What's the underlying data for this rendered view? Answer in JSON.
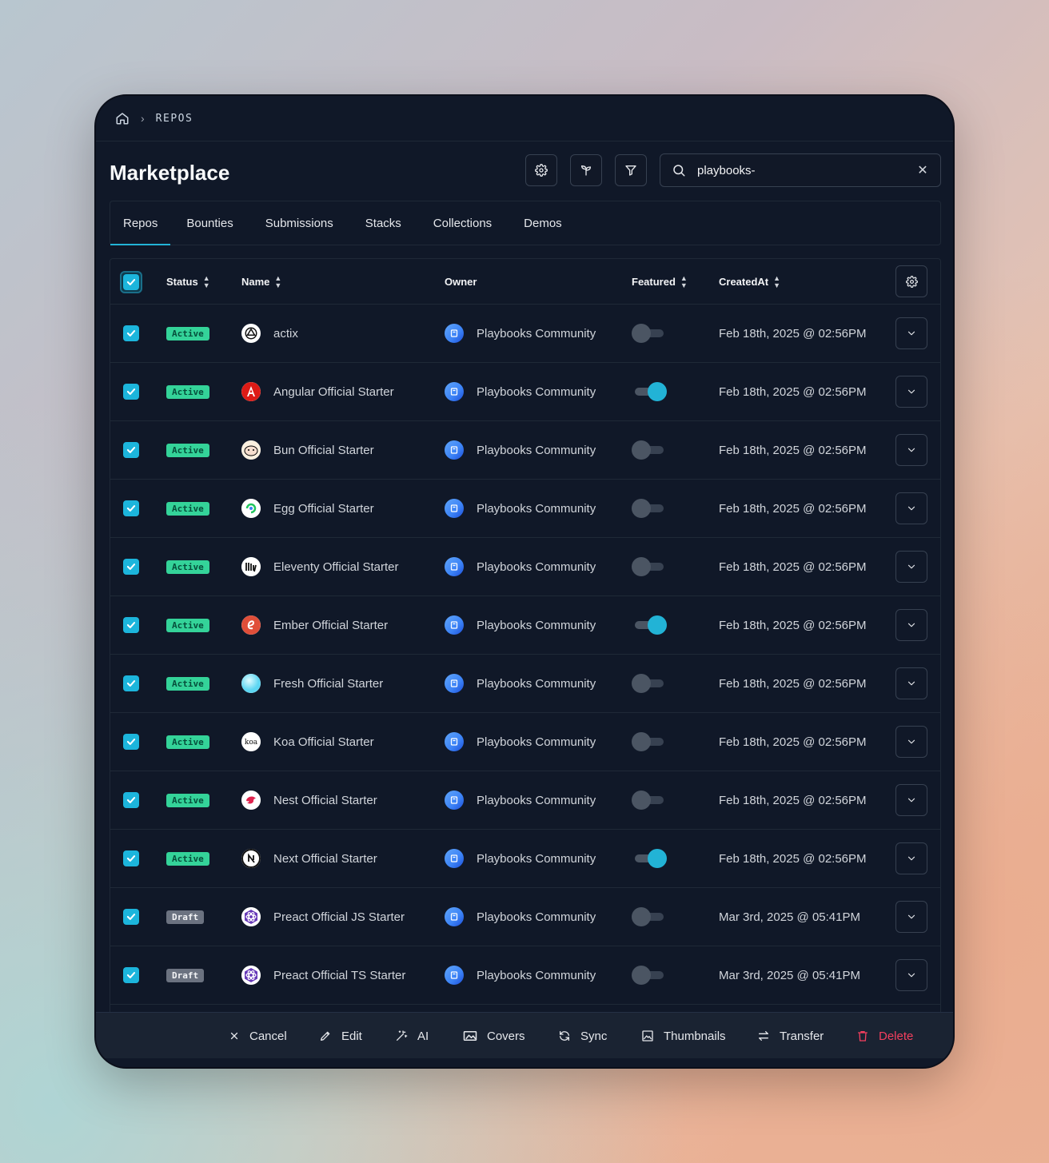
{
  "breadcrumb": {
    "home_icon": "home-icon",
    "current": "REPOS"
  },
  "header": {
    "title": "Marketplace"
  },
  "search": {
    "value": "playbooks-",
    "placeholder": "Search"
  },
  "tabs": [
    {
      "label": "Repos",
      "active": true
    },
    {
      "label": "Bounties",
      "active": false
    },
    {
      "label": "Submissions",
      "active": false
    },
    {
      "label": "Stacks",
      "active": false
    },
    {
      "label": "Collections",
      "active": false
    },
    {
      "label": "Demos",
      "active": false
    }
  ],
  "table": {
    "columns": {
      "status": "Status",
      "name": "Name",
      "owner": "Owner",
      "featured": "Featured",
      "created": "CreatedAt"
    },
    "rows": [
      {
        "status": "Active",
        "name": "actix",
        "owner": "Playbooks Community",
        "featured": false,
        "created": "Feb 18th, 2025 @ 02:56PM"
      },
      {
        "status": "Active",
        "name": "Angular Official Starter",
        "owner": "Playbooks Community",
        "featured": true,
        "created": "Feb 18th, 2025 @ 02:56PM"
      },
      {
        "status": "Active",
        "name": "Bun Official Starter",
        "owner": "Playbooks Community",
        "featured": false,
        "created": "Feb 18th, 2025 @ 02:56PM"
      },
      {
        "status": "Active",
        "name": "Egg Official Starter",
        "owner": "Playbooks Community",
        "featured": false,
        "created": "Feb 18th, 2025 @ 02:56PM"
      },
      {
        "status": "Active",
        "name": "Eleventy Official Starter",
        "owner": "Playbooks Community",
        "featured": false,
        "created": "Feb 18th, 2025 @ 02:56PM"
      },
      {
        "status": "Active",
        "name": "Ember Official Starter",
        "owner": "Playbooks Community",
        "featured": true,
        "created": "Feb 18th, 2025 @ 02:56PM"
      },
      {
        "status": "Active",
        "name": "Fresh Official Starter",
        "owner": "Playbooks Community",
        "featured": false,
        "created": "Feb 18th, 2025 @ 02:56PM"
      },
      {
        "status": "Active",
        "name": "Koa Official Starter",
        "owner": "Playbooks Community",
        "featured": false,
        "created": "Feb 18th, 2025 @ 02:56PM"
      },
      {
        "status": "Active",
        "name": "Nest Official Starter",
        "owner": "Playbooks Community",
        "featured": false,
        "created": "Feb 18th, 2025 @ 02:56PM"
      },
      {
        "status": "Active",
        "name": "Next Official Starter",
        "owner": "Playbooks Community",
        "featured": true,
        "created": "Feb 18th, 2025 @ 02:56PM"
      },
      {
        "status": "Draft",
        "name": "Preact Official JS Starter",
        "owner": "Playbooks Community",
        "featured": false,
        "created": "Mar 3rd, 2025 @ 05:41PM"
      },
      {
        "status": "Draft",
        "name": "Preact Official TS Starter",
        "owner": "Playbooks Community",
        "featured": false,
        "created": "Mar 3rd, 2025 @ 05:41PM"
      }
    ]
  },
  "actions": {
    "cancel": "Cancel",
    "edit": "Edit",
    "ai": "AI",
    "covers": "Covers",
    "sync": "Sync",
    "thumbnails": "Thumbnails",
    "transfer": "Transfer",
    "delete": "Delete"
  },
  "colors": {
    "accent": "#22b3d6",
    "active_badge": "#34d399",
    "draft_badge": "#6b7280",
    "danger": "#f43f5e",
    "background": "#101828"
  }
}
